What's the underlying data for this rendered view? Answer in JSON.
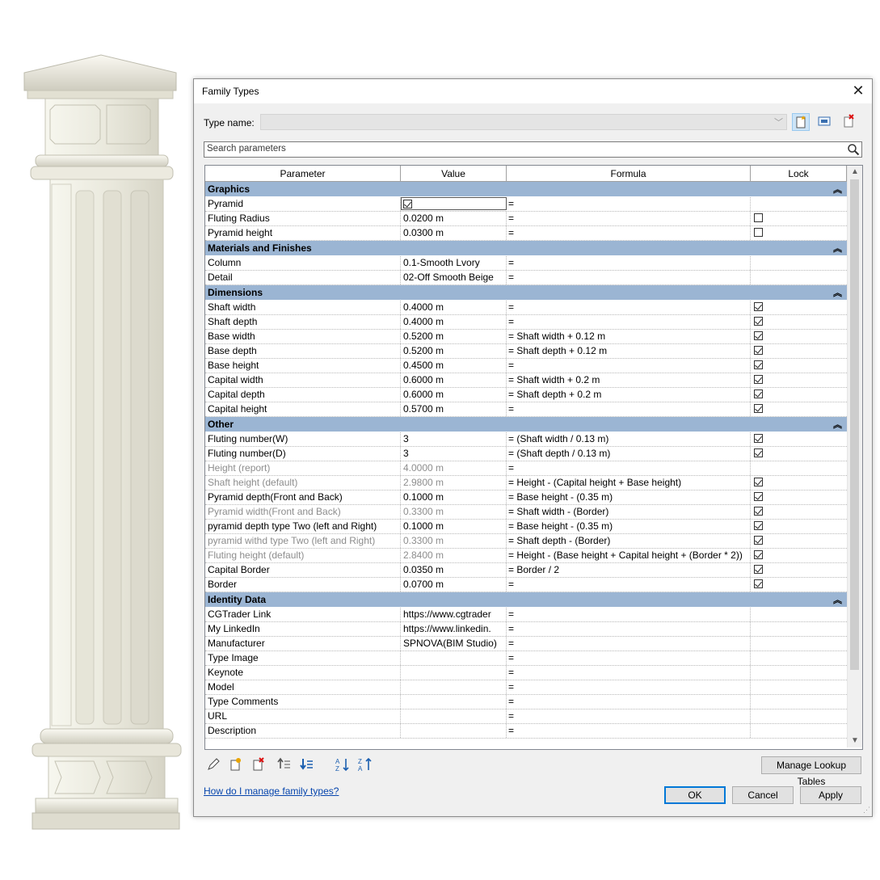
{
  "dialog": {
    "title": "Family Types",
    "type_name_label": "Type name:",
    "type_name_value": "",
    "search_placeholder": "Search parameters"
  },
  "grid": {
    "columns": [
      "Parameter",
      "Value",
      "Formula",
      "Lock"
    ],
    "groups": [
      {
        "name": "Graphics",
        "rows": [
          {
            "param": "Pyramid",
            "value": "",
            "value_checkbox": true,
            "value_checked": true,
            "formula": "=",
            "lock": "none"
          },
          {
            "param": "Fluting Radius",
            "value": "0.0200 m",
            "formula": "=",
            "lock": "unchecked"
          },
          {
            "param": "Pyramid height",
            "value": "0.0300 m",
            "formula": "=",
            "lock": "unchecked"
          }
        ]
      },
      {
        "name": "Materials and Finishes",
        "rows": [
          {
            "param": "Column",
            "value": "0.1-Smooth Lvory",
            "formula": "=",
            "lock": "none"
          },
          {
            "param": "Detail",
            "value": "02-Off Smooth Beige",
            "formula": "=",
            "lock": "none"
          }
        ]
      },
      {
        "name": "Dimensions",
        "rows": [
          {
            "param": "Shaft width",
            "value": "0.4000 m",
            "formula": "=",
            "lock": "checked"
          },
          {
            "param": "Shaft depth",
            "value": "0.4000 m",
            "formula": "=",
            "lock": "checked"
          },
          {
            "param": "Base width",
            "value": "0.5200 m",
            "formula": "= Shaft width + 0.12 m",
            "lock": "checked"
          },
          {
            "param": "Base depth",
            "value": "0.5200 m",
            "formula": "= Shaft depth + 0.12 m",
            "lock": "checked"
          },
          {
            "param": "Base height",
            "value": "0.4500 m",
            "formula": "=",
            "lock": "checked"
          },
          {
            "param": "Capital width",
            "value": "0.6000 m",
            "formula": "= Shaft width + 0.2 m",
            "lock": "checked"
          },
          {
            "param": "Capital depth",
            "value": "0.6000 m",
            "formula": "= Shaft depth + 0.2 m",
            "lock": "checked"
          },
          {
            "param": "Capital height",
            "value": "0.5700 m",
            "formula": "=",
            "lock": "checked"
          }
        ]
      },
      {
        "name": "Other",
        "rows": [
          {
            "param": "Fluting number(W)",
            "value": "3",
            "formula": "= (Shaft width / 0.13 m)",
            "lock": "checked"
          },
          {
            "param": "Fluting number(D)",
            "value": "3",
            "formula": "= (Shaft depth / 0.13 m)",
            "lock": "checked"
          },
          {
            "param": "Height (report)",
            "value": "4.0000 m",
            "formula": "=",
            "lock": "none",
            "grey": true
          },
          {
            "param": "Shaft height (default)",
            "value": "2.9800 m",
            "formula": "= Height - (Capital height + Base height)",
            "lock": "checked",
            "grey": true
          },
          {
            "param": "Pyramid depth(Front and Back)",
            "value": "0.1000 m",
            "formula": "= Base height - (0.35 m)",
            "lock": "checked"
          },
          {
            "param": "Pyramid width(Front and Back)",
            "value": "0.3300 m",
            "formula": "= Shaft width - (Border)",
            "lock": "checked",
            "grey": true
          },
          {
            "param": "pyramid depth type Two (left and Right)",
            "value": "0.1000 m",
            "formula": "= Base height - (0.35 m)",
            "lock": "checked"
          },
          {
            "param": "pyramid withd type Two (left and Right)",
            "value": "0.3300 m",
            "formula": "= Shaft depth - (Border)",
            "lock": "checked",
            "grey": true
          },
          {
            "param": "Fluting height (default)",
            "value": "2.8400 m",
            "formula": "= Height - (Base height + Capital height + (Border * 2))",
            "lock": "checked",
            "grey": true
          },
          {
            "param": "Capital Border",
            "value": "0.0350 m",
            "formula": "= Border / 2",
            "lock": "checked"
          },
          {
            "param": "Border",
            "value": "0.0700 m",
            "formula": "=",
            "lock": "checked"
          }
        ]
      },
      {
        "name": "Identity Data",
        "rows": [
          {
            "param": "CGTrader Link",
            "value": "https://www.cgtrader",
            "formula": "=",
            "lock": "none"
          },
          {
            "param": "My LinkedIn",
            "value": "https://www.linkedin.",
            "formula": "=",
            "lock": "none"
          },
          {
            "param": "Manufacturer",
            "value": "SPNOVA(BIM Studio)",
            "formula": "=",
            "lock": "none"
          },
          {
            "param": "Type Image",
            "value": "",
            "formula": "=",
            "lock": "none"
          },
          {
            "param": "Keynote",
            "value": "",
            "formula": "=",
            "lock": "none"
          },
          {
            "param": "Model",
            "value": "",
            "formula": "=",
            "lock": "none"
          },
          {
            "param": "Type Comments",
            "value": "",
            "formula": "=",
            "lock": "none"
          },
          {
            "param": "URL",
            "value": "",
            "formula": "=",
            "lock": "none"
          },
          {
            "param": "Description",
            "value": "",
            "formula": "=",
            "lock": "none"
          }
        ]
      }
    ]
  },
  "footer": {
    "manage_lookup_label": "Manage Lookup Tables",
    "help_link": "How do I manage family types?",
    "ok_label": "OK",
    "cancel_label": "Cancel",
    "apply_label": "Apply"
  },
  "colors": {
    "group_header": "#9bb5d3",
    "link": "#0645ad",
    "column_stone": "#ecebe1"
  },
  "icons": {
    "toolbar": [
      "new-type-icon",
      "rename-type-icon",
      "delete-type-icon"
    ],
    "bottom": [
      "edit-parameter-icon",
      "new-parameter-icon",
      "delete-parameter-icon",
      "move-up-icon",
      "move-down-icon",
      "sort-ascending-icon",
      "sort-descending-icon"
    ]
  }
}
